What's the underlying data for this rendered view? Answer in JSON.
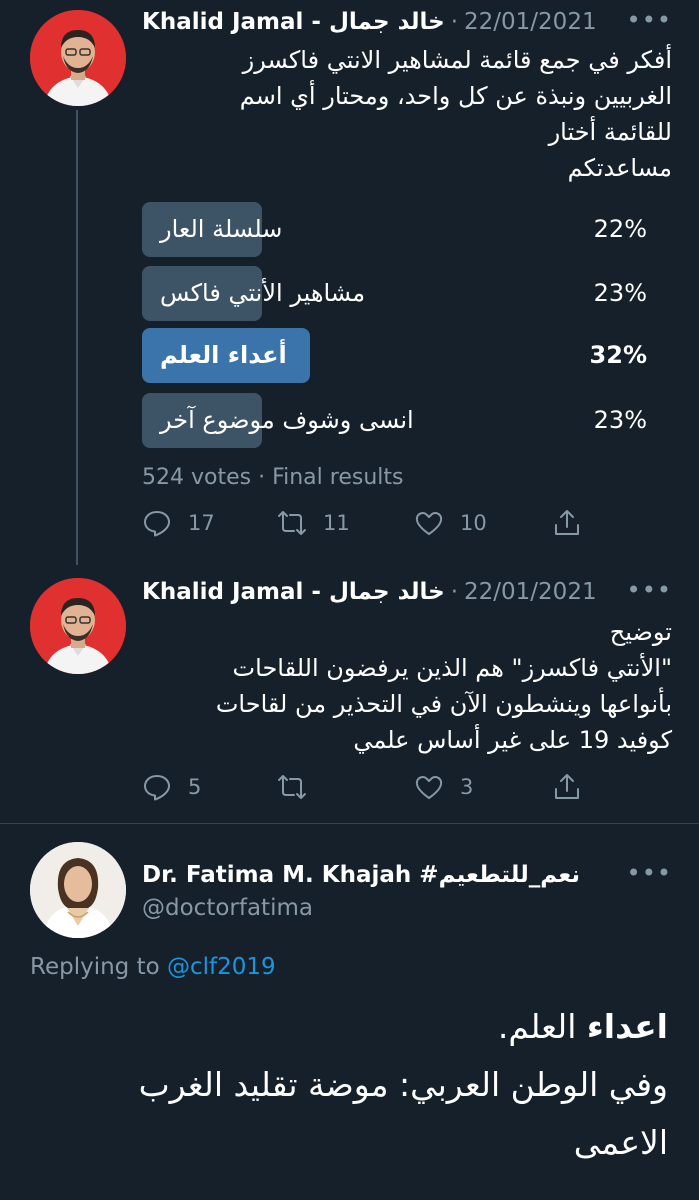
{
  "tweet1": {
    "author": "Khalid Jamal - خالد جمال",
    "date": "22/01/2021",
    "more": "•••",
    "lines": [
      "أفكر في جمع قائمة لمشاهير الانتي فاكسرز",
      "الغربيين ونبذة عن كل واحد، ومحتار أي اسم",
      "للقائمة أختار",
      "مساعدتكم"
    ],
    "poll": {
      "options": [
        {
          "label": "سلسلة العار",
          "percent": "22%",
          "value": 22,
          "winner": false
        },
        {
          "label": "مشاهير الأنتي فاكس",
          "percent": "23%",
          "value": 23,
          "winner": false
        },
        {
          "label": "أعداء العلم",
          "percent": "32%",
          "value": 32,
          "winner": true
        },
        {
          "label": "انسى وشوف موضوع آخر",
          "percent": "23%",
          "value": 23,
          "winner": false
        }
      ],
      "summary": "524 votes · Final results"
    },
    "actions": {
      "replies": "17",
      "retweets": "11",
      "likes": "10"
    }
  },
  "tweet2": {
    "author": "Khalid Jamal - خالد جمال",
    "date": "22/01/2021",
    "more": "•••",
    "lines": [
      "توضيح",
      "\"الأنتي فاكسرز\" هم الذين يرفضون اللقاحات",
      "بأنواعها وينشطون الآن في التحذير من لقاحات",
      "كوفيد 19 على غير أساس علمي"
    ],
    "actions": {
      "replies": "5",
      "retweets": "",
      "likes": "3"
    }
  },
  "reply": {
    "author": "Dr. Fatima M. Khajah #نعم_للتطعيم",
    "handle": "@doctorfatima",
    "more": "•••",
    "replying_prefix": "Replying to",
    "replying_to": "@clf2019",
    "bold_word": "اعداء",
    "line1_rest": " العلم.",
    "line2": "وفي الوطن العربي: موضة تقليد الغرب",
    "line3": "الاعمى"
  },
  "colors": {
    "background": "#15202b",
    "secondary_text": "#8899a6",
    "poll_bar": "#3d5466",
    "poll_winner": "#3a74aa",
    "link": "#1b95e0"
  }
}
